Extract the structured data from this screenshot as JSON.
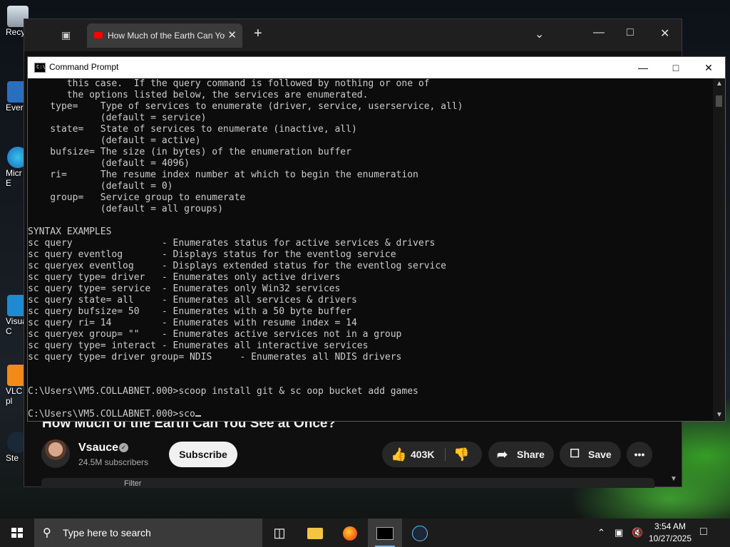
{
  "desktop": {
    "icons": [
      {
        "label": "Recy"
      },
      {
        "label": "Ever"
      },
      {
        "label": "Micr E"
      },
      {
        "label": "Visua C"
      },
      {
        "label": "VLC pl"
      },
      {
        "label": "Ste"
      }
    ]
  },
  "browser": {
    "tab_title": "How Much of the Earth Can You",
    "new_tab_symbol": "+",
    "video": {
      "title": "How Much of the Earth Can You See at Once?",
      "channel": "Vsauce",
      "subscribers": "24.5M subscribers",
      "subscribe_label": "Subscribe",
      "likes": "403K",
      "share_label": "Share",
      "save_label": "Save",
      "filter_label": "Filter"
    }
  },
  "cmd": {
    "title": "Command Prompt",
    "lines": [
      "       this case.  If the query command is followed by nothing or one of",
      "       the options listed below, the services are enumerated.",
      "    type=    Type of services to enumerate (driver, service, userservice, all)",
      "             (default = service)",
      "    state=   State of services to enumerate (inactive, all)",
      "             (default = active)",
      "    bufsize= The size (in bytes) of the enumeration buffer",
      "             (default = 4096)",
      "    ri=      The resume index number at which to begin the enumeration",
      "             (default = 0)",
      "    group=   Service group to enumerate",
      "             (default = all groups)",
      "",
      "SYNTAX EXAMPLES",
      "sc query                - Enumerates status for active services & drivers",
      "sc query eventlog       - Displays status for the eventlog service",
      "sc queryex eventlog     - Displays extended status for the eventlog service",
      "sc query type= driver   - Enumerates only active drivers",
      "sc query type= service  - Enumerates only Win32 services",
      "sc query state= all     - Enumerates all services & drivers",
      "sc query bufsize= 50    - Enumerates with a 50 byte buffer",
      "sc query ri= 14         - Enumerates with resume index = 14",
      "sc queryex group= \"\"    - Enumerates active services not in a group",
      "sc query type= interact - Enumerates all interactive services",
      "sc query type= driver group= NDIS     - Enumerates all NDIS drivers",
      "",
      "",
      "C:\\Users\\VM5.COLLABNET.000>scoop install git & sc oop bucket add games",
      ""
    ],
    "prompt_line": "C:\\Users\\VM5.COLLABNET.000>sco"
  },
  "taskbar": {
    "search_placeholder": "Type here to search",
    "time": "3:54 AM",
    "date": "10/27/2025"
  }
}
